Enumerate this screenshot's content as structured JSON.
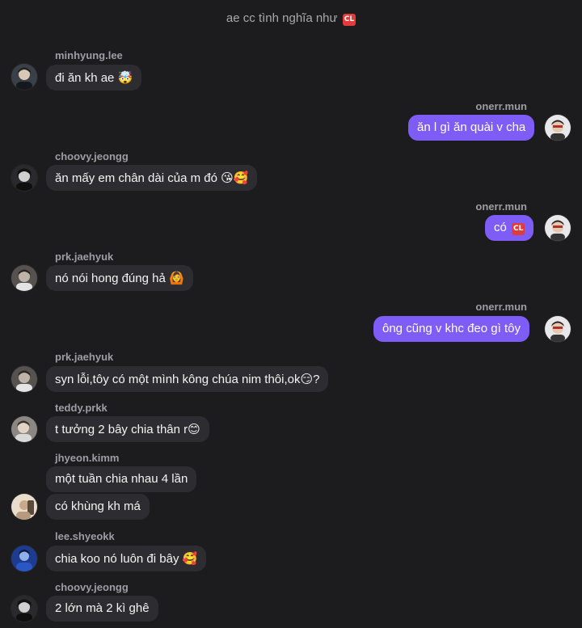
{
  "chat": {
    "title": "ae cc tình nghĩa như",
    "title_badge": "CL"
  },
  "messages": [
    {
      "user": "minhyung.lee",
      "text": "đi ăn kh ae",
      "emoji": "🤯"
    },
    {
      "user": "onerr.mun",
      "text": "ăn l gì ăn quài v cha",
      "emoji": ""
    },
    {
      "user": "choovy.jeongg",
      "text": "ăn mấy em chân dài của m đó",
      "emoji": "😘🥰"
    },
    {
      "user": "onerr.mun",
      "text": "có",
      "badge": "CL"
    },
    {
      "user": "prk.jaehyuk",
      "text": "nó nói hong đúng hả",
      "emoji": "🙆"
    },
    {
      "user": "onerr.mun",
      "text": "ông cũng v khc đeo gì tôy",
      "emoji": ""
    },
    {
      "user": "prk.jaehyuk",
      "text": "syn lỗi,tôy có một mình kông chúa nim thôi,ok",
      "emoji": "😏",
      "suffix": "?"
    },
    {
      "user": "teddy.prkk",
      "text": "t tưởng 2 bây chia thân r",
      "emoji": "😊"
    },
    {
      "user": "jhyeon.kimm",
      "text": "một tuần chia nhau 4 lần",
      "emoji": ""
    },
    {
      "user": "jhyeon.kimm",
      "text": "có khùng kh má",
      "emoji": ""
    },
    {
      "user": "lee.shyeokk",
      "text": "chia koo nó luôn đi bây",
      "emoji": "🥰"
    },
    {
      "user": "choovy.jeongg",
      "text": "2 lớn mà 2 kì ghê",
      "emoji": ""
    }
  ],
  "colors": {
    "background": "#1c1c1f",
    "incoming_bubble": "#2d2d31",
    "outgoing_bubble": "#7e5cf6",
    "username": "#9d9da3",
    "badge": "#e23b3b"
  }
}
